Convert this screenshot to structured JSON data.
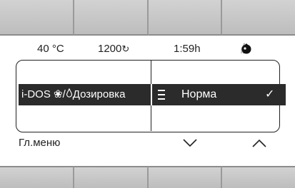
{
  "status": {
    "temperature": "40 °C",
    "spin_value": "1200",
    "spin_icon": "spin-icon",
    "time": "1:59h",
    "icons": [
      "flower-icon",
      "drop-icon",
      "detergent-icon"
    ],
    "separator": "/"
  },
  "selection": {
    "left_prefix": "i-DOS",
    "left_icons": [
      "flower-icon",
      "drop-icon"
    ],
    "left_sep": "/",
    "left_label": "Дозировка",
    "right_label": "Норма",
    "check_icon": "check-icon",
    "menu_icon": "menu-icon"
  },
  "softkeys": {
    "main_menu": "Гл.меню",
    "down_icon": "chevron-down-icon",
    "up_icon": "chevron-up-icon"
  },
  "colors": {
    "highlight": "#2b2b2b",
    "key": "#c8c8c8",
    "dim_icon": "#aaaaaa"
  }
}
